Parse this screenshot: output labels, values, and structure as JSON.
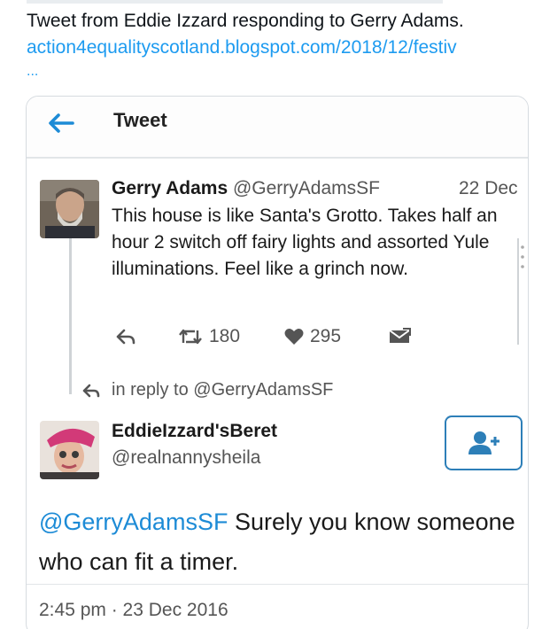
{
  "post": {
    "caption": "Tweet from Eddie Izzard responding to Gerry Adams.",
    "link": "action4equalityscotland.blogspot.com/2018/12/festiv",
    "link_ellipsis": "..."
  },
  "screenshot": {
    "header_title": "Tweet",
    "tweet1": {
      "name": "Gerry Adams",
      "handle": "@GerryAdamsSF",
      "date": "22 Dec",
      "text": "This house is like Santa's Grotto. Takes half an hour 2 switch off fairy lights and assorted Yule illuminations. Feel like a grinch now.",
      "retweets": "180",
      "likes": "295"
    },
    "in_reply_to": "in reply to @GerryAdamsSF",
    "tweet2": {
      "name": "EddieIzzard'sBeret",
      "handle": "@realnannysheila",
      "mention": "@GerryAdamsSF",
      "text": " Surely you know someone who can fit a timer.",
      "timestamp": "2:45 pm · 23 Dec 2016"
    }
  },
  "icons": {
    "back": "arrow-left-icon",
    "reply": "reply-icon",
    "retweet": "retweet-icon",
    "like": "heart-icon",
    "dm": "envelope-icon",
    "follow": "add-user-icon"
  },
  "colors": {
    "link": "#1d9bf0",
    "mention": "#1d8bd6",
    "follow_border": "#2d7fb8"
  }
}
